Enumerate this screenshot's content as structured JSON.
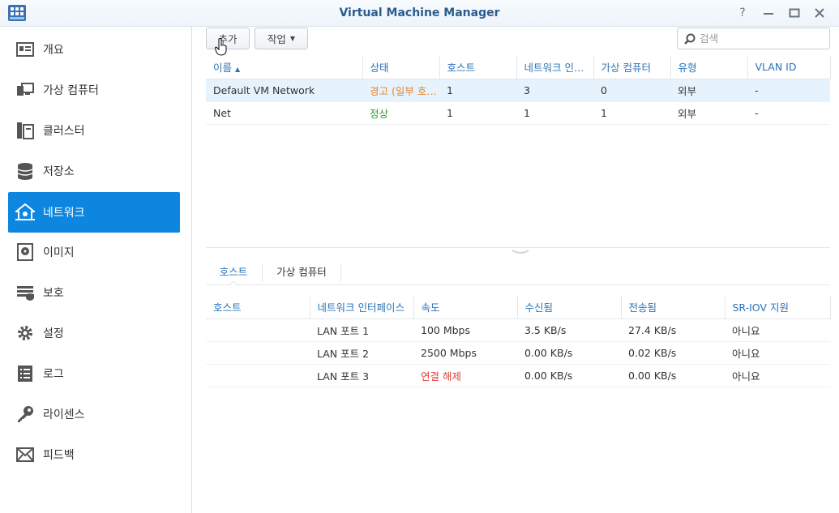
{
  "window": {
    "title": "Virtual Machine Manager",
    "help_icon": "help-icon",
    "minimize_icon": "minimize-icon",
    "maximize_icon": "maximize-icon",
    "close_icon": "close-icon"
  },
  "sidebar": {
    "items": [
      {
        "label": "개요",
        "icon": "overview-icon"
      },
      {
        "label": "가상 컴퓨터",
        "icon": "virtual-machine-icon"
      },
      {
        "label": "클러스터",
        "icon": "cluster-icon"
      },
      {
        "label": "저장소",
        "icon": "storage-icon"
      },
      {
        "label": "네트워크",
        "icon": "network-icon",
        "active": true
      },
      {
        "label": "이미지",
        "icon": "image-icon"
      },
      {
        "label": "보호",
        "icon": "protection-icon"
      },
      {
        "label": "설정",
        "icon": "settings-icon"
      },
      {
        "label": "로그",
        "icon": "log-icon"
      },
      {
        "label": "라이센스",
        "icon": "license-icon"
      },
      {
        "label": "피드백",
        "icon": "feedback-icon"
      }
    ]
  },
  "toolbar": {
    "add_label": "추가",
    "action_label": "작업",
    "search_placeholder": "검색"
  },
  "networks": {
    "headers": [
      "이름",
      "상태",
      "호스트",
      "네트워크 인터페이스",
      "가상 컴퓨터",
      "유형",
      "VLAN ID"
    ],
    "sort_indicator": "▲",
    "rows": [
      {
        "name": "Default VM Network",
        "status": "경고 (일부 호스트)",
        "hosts": "1",
        "interfaces": "3",
        "vms": "0",
        "type": "외부",
        "vlan": "-"
      },
      {
        "name": "Net",
        "status": "정상",
        "hosts": "1",
        "interfaces": "1",
        "vms": "1",
        "type": "외부",
        "vlan": "-"
      }
    ]
  },
  "detail": {
    "tabs": [
      "호스트",
      "가상 컴퓨터"
    ],
    "headers": [
      "호스트",
      "네트워크 인터페이스",
      "속도",
      "수신됨",
      "전송됨",
      "SR-IOV 지원"
    ],
    "rows": [
      {
        "host": "",
        "iface": "LAN 포트 1",
        "speed": "100 Mbps",
        "rx": "3.5 KB/s",
        "tx": "27.4 KB/s",
        "sriov": "아니요"
      },
      {
        "host": "",
        "iface": "LAN 포트 2",
        "speed": "2500 Mbps",
        "rx": "0.00 KB/s",
        "tx": "0.02 KB/s",
        "sriov": "아니요"
      },
      {
        "host": "",
        "iface": "LAN 포트 3",
        "speed": "연결 해제",
        "rx": "0.00 KB/s",
        "tx": "0.00 KB/s",
        "sriov": "아니요"
      }
    ]
  },
  "colors": {
    "accent": "#0d86e0",
    "header_text": "#2a73b8",
    "warning": "#e8832a",
    "ok": "#2ca02c",
    "error": "#e0433a"
  }
}
